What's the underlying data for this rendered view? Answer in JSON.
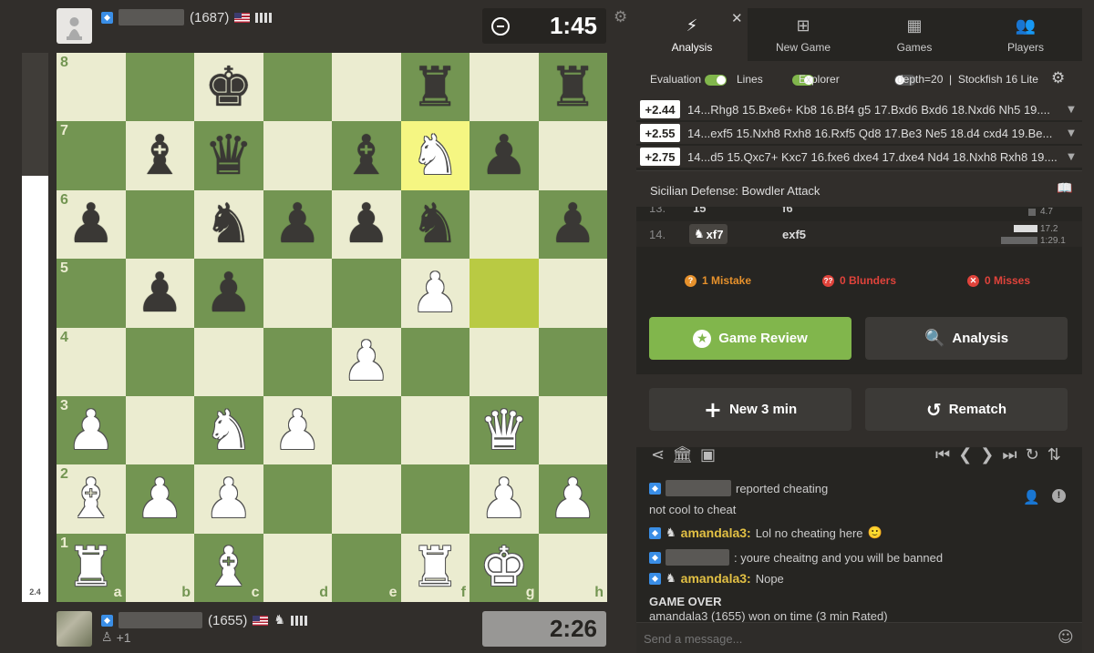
{
  "eval_bar": {
    "label": "2.4",
    "white_fraction": 0.776
  },
  "top_player": {
    "rating": "(1687)",
    "flag": "us-flag",
    "clock": "1:45"
  },
  "bottom_player": {
    "rating": "(1655)",
    "flag": "us-flag",
    "extra": "+1",
    "clock": "2:26"
  },
  "board": {
    "ranks": [
      "8",
      "7",
      "6",
      "5",
      "4",
      "3",
      "2",
      "1"
    ],
    "files": [
      "a",
      "b",
      "c",
      "d",
      "e",
      "f",
      "g",
      "h"
    ],
    "highlights": [
      "f7",
      "g5"
    ],
    "rows": [
      [
        "",
        "",
        "bk",
        "",
        "",
        "br",
        "",
        "br"
      ],
      [
        "",
        "bb",
        "bq",
        "",
        "bb",
        "wn",
        "bp",
        ""
      ],
      [
        "bp",
        "",
        "bn",
        "bp",
        "bp",
        "bn",
        "",
        "bp"
      ],
      [
        "",
        "bp",
        "bp",
        "",
        "",
        "wp",
        "",
        ""
      ],
      [
        "",
        "",
        "",
        "",
        "wp",
        "",
        "",
        ""
      ],
      [
        "wp",
        "",
        "wn",
        "wp",
        "",
        "",
        "wq",
        ""
      ],
      [
        "wb",
        "wp",
        "wp",
        "",
        "",
        "",
        "wp",
        "wp"
      ],
      [
        "wr",
        "",
        "wb",
        "",
        "",
        "wr",
        "wk",
        ""
      ]
    ]
  },
  "tabs": [
    {
      "label": "Analysis",
      "icon": "lightning-icon"
    },
    {
      "label": "New Game",
      "icon": "plus-square-icon"
    },
    {
      "label": "Games",
      "icon": "board-icon"
    },
    {
      "label": "Players",
      "icon": "people-icon"
    }
  ],
  "settings": {
    "evaluation": "Evaluation",
    "lines": "Lines",
    "explorer": "Explorer",
    "engine": "depth=20  |  Stockfish 16 Lite"
  },
  "engine_lines": [
    {
      "score": "+2.44",
      "moves": "14...Rhg8 15.Bxe6+ Kb8 16.Bf4 g5 17.Bxd6 Bxd6 18.Nxd6 Nh5 19...."
    },
    {
      "score": "+2.55",
      "moves": "14...exf5 15.Nxh8 Rxh8 16.Rxf5 Qd8 17.Be3 Ne5 18.d4 cxd4 19.Be..."
    },
    {
      "score": "+2.75",
      "moves": "14...d5 15.Qxc7+ Kxc7 16.fxe6 dxe4 17.dxe4 Nd4 18.Nxh8 Rxh8 19...."
    }
  ],
  "opening": "Sicilian Defense: Bowdler Attack",
  "move_list": {
    "partial": {
      "num": "13.",
      "w": "15",
      "b": "f6",
      "time": "4.7"
    },
    "row": {
      "num": "14.",
      "w": "xf7",
      "b": "exf5",
      "t1": "17.2",
      "t2": "1:29.1"
    }
  },
  "stats": {
    "mistake": "1 Mistake",
    "blunders": "0 Blunders",
    "misses": "0 Misses"
  },
  "buttons": {
    "review": "Game Review",
    "analysis": "Analysis",
    "new_game": "New 3 min",
    "rematch": "Rematch"
  },
  "chat": [
    {
      "type": "hidden-name",
      "text": "reported cheating"
    },
    {
      "type": "plain",
      "text": "not cool to cheat"
    },
    {
      "type": "named",
      "name": "amandala3:",
      "text": "Lol no cheating here",
      "emoji": "🙂"
    },
    {
      "type": "hidden-name",
      "text": ": youre cheaitng and you will be banned"
    },
    {
      "type": "named",
      "name": "amandala3:",
      "text": "Nope"
    }
  ],
  "game_over": {
    "title": "GAME OVER",
    "detail": "amandala3 (1655) won on time (3 min Rated)"
  },
  "message_placeholder": "Send a message..."
}
